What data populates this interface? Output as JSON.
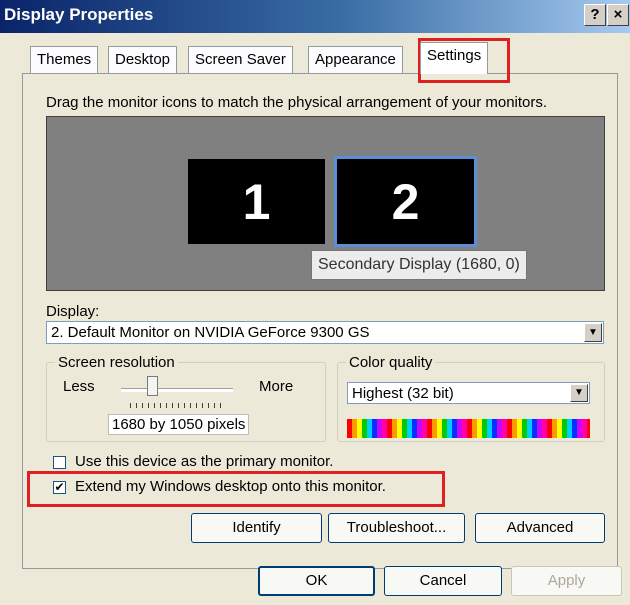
{
  "window": {
    "title": "Display Properties",
    "help_button": "?",
    "close_button": "×"
  },
  "tabs": [
    {
      "label": "Themes"
    },
    {
      "label": "Desktop"
    },
    {
      "label": "Screen Saver"
    },
    {
      "label": "Appearance"
    },
    {
      "label": "Settings"
    }
  ],
  "instruction": "Drag the monitor icons to match the physical arrangement of your monitors.",
  "monitors": [
    {
      "label": "1"
    },
    {
      "label": "2"
    }
  ],
  "tooltip": "Secondary Display (1680, 0)",
  "display": {
    "label": "Display:",
    "value": "2. Default Monitor on NVIDIA GeForce 9300 GS"
  },
  "resolution": {
    "group_label": "Screen resolution",
    "less": "Less",
    "more": "More",
    "value": "1680 by 1050 pixels"
  },
  "color_quality": {
    "group_label": "Color quality",
    "value": "Highest (32 bit)"
  },
  "checkboxes": {
    "primary": {
      "label": "Use this device as the primary monitor.",
      "checked": false
    },
    "extend": {
      "label": "Extend my Windows desktop onto this monitor.",
      "checked": true,
      "mark": "✔"
    }
  },
  "buttons": {
    "identify": "Identify",
    "troubleshoot": "Troubleshoot...",
    "advanced": "Advanced",
    "ok": "OK",
    "cancel": "Cancel",
    "apply": "Apply"
  },
  "colors": {
    "highlight": "#e02020",
    "selected_monitor_border": "#5a8fd6"
  }
}
